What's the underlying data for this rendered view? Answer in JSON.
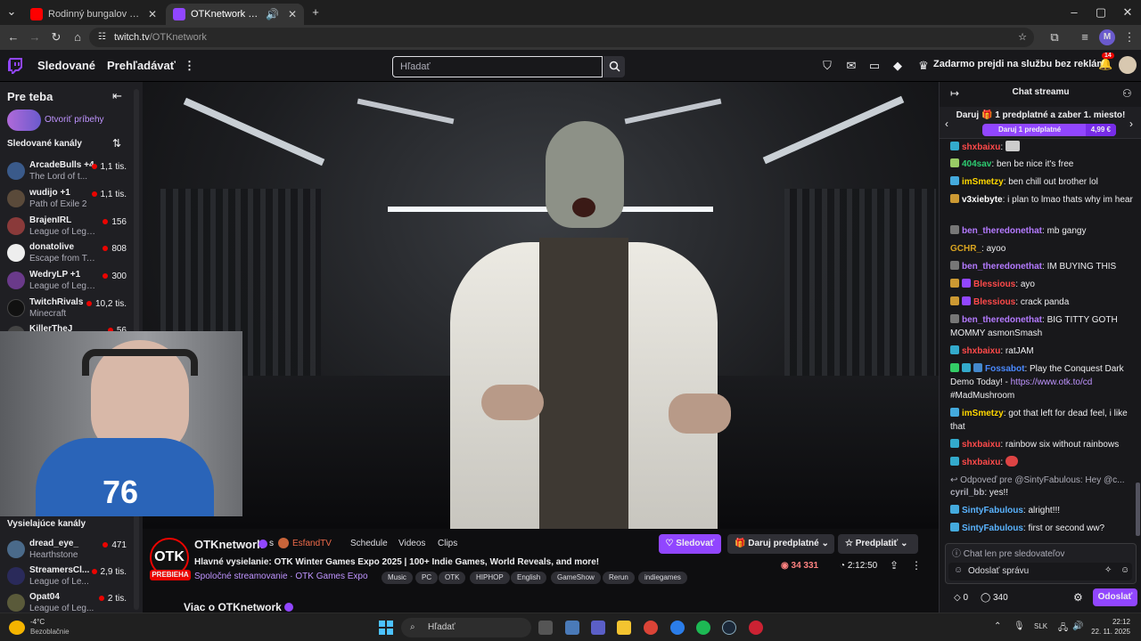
{
  "browser": {
    "tabs": [
      {
        "label": "Rodinný bungalov na pláži len ...",
        "favicon_color": "#ff0000"
      },
      {
        "label": "OTKnetwork - Twitch",
        "favicon_color": "#9146ff"
      }
    ],
    "url_host": "twitch.tv",
    "url_path": "/OTKnetwork",
    "profile_initial": "M"
  },
  "topnav": {
    "following": "Sledované",
    "browse": "Prehľadávať",
    "search_placeholder": "Hľadať",
    "prime_label": "Zadarmo prejdi na službu bez reklám",
    "notif_count": "14"
  },
  "sidebar": {
    "for_you": "Pre teba",
    "stories": "Otvoriť príbehy",
    "followed_title": "Sledované kanály",
    "followed": [
      {
        "name": "ArcadeBulls +4",
        "game": "The Lord of t...",
        "viewers": "1,1 tis.",
        "color": "#3a5a8a"
      },
      {
        "name": "wudijo +1",
        "game": "Path of Exile 2",
        "viewers": "1,1 tis.",
        "color": "#5a4a3a"
      },
      {
        "name": "BrajenIRL",
        "game": "League of Lege...",
        "viewers": "156",
        "color": "#8a3a3a"
      },
      {
        "name": "donatolive",
        "game": "Escape from Ta...",
        "viewers": "808",
        "color": "#eeeeee"
      },
      {
        "name": "WedryLP +1",
        "game": "League of Lege...",
        "viewers": "300",
        "color": "#6a3a8a"
      },
      {
        "name": "TwitchRivals",
        "game": "Minecraft",
        "viewers": "10,2 tis.",
        "color": "#111111"
      },
      {
        "name": "KillerTheJ",
        "game": "",
        "viewers": "56",
        "color": "#444444"
      }
    ],
    "live_title": "Vysielajúce kanály",
    "live": [
      {
        "name": "dread_eye_",
        "game": "Hearthstone",
        "viewers": "471",
        "color": "#4a6a8a"
      },
      {
        "name": "StreamersCl...",
        "game": "League of Le...",
        "viewers": "2,9 tis.",
        "color": "#2a2a5a"
      },
      {
        "name": "Opat04",
        "game": "League of Leg...",
        "viewers": "2 tis.",
        "color": "#5a5a3a"
      }
    ]
  },
  "channel": {
    "name": "OTKnetwork",
    "with_label": "s",
    "partner": "EsfandTV",
    "links": [
      "Schedule",
      "Videos",
      "Clips"
    ],
    "live_badge": "PREBIEHA",
    "title": "Hlavné vysielanie: OTK Winter Games Expo 2025 | 100+ Indie Games, World Reveals, and more!",
    "collab": "Spoločné streamovanie",
    "game": "OTK Games Expo",
    "tags": [
      "Music",
      "PC",
      "OTK",
      "HIPHOP",
      "English",
      "GameShow",
      "Rerun",
      "indiegames"
    ],
    "follow": "Sledovať",
    "gift": "Daruj predplatné",
    "subscribe": "Predplatiť",
    "viewers": "34 331",
    "uptime": "2:12:50",
    "about": "Viac o OTKnetwork"
  },
  "chat": {
    "title": "Chat streamu",
    "gift_banner": "Daruj 🎁 1 predplatné a zaber 1. miesto!",
    "gift_button": "Daruj 1 predplatné",
    "gift_price": "4,99 €",
    "messages": [
      {
        "user": "shxbaixu",
        "color": "#ff4a4a",
        "text": ""
      },
      {
        "user": "404sav",
        "color": "#2ecc71",
        "text": "ben be nice it's free"
      },
      {
        "user": "imSmetzy",
        "color": "#ffd700",
        "text": "ben chill out brother lol"
      },
      {
        "user": "v3xiebyte",
        "color": "#ffffff",
        "text": "i plan to lmao thats why im hear"
      },
      {
        "user": "ben_theredonethat",
        "color": "#b47aff",
        "text": "mb gangy"
      },
      {
        "user": "GCHR_",
        "color": "#daa520",
        "text": "ayoo"
      },
      {
        "user": "ben_theredonethat",
        "color": "#b47aff",
        "text": "IM BUYING THIS"
      },
      {
        "user": "Blessious",
        "color": "#ff4a4a",
        "text": "ayo"
      },
      {
        "user": "Blessious",
        "color": "#ff4a4a",
        "text": "crack panda"
      },
      {
        "user": "ben_theredonethat",
        "color": "#b47aff",
        "text": "BIG TITTY GOTH MOMMY asmonSmash"
      },
      {
        "user": "shxbaixu",
        "color": "#ff4a4a",
        "text": "ratJAM"
      },
      {
        "user": "Fossabot",
        "color": "#4a8aff",
        "text": "Play the Conquest Dark Demo Today! -",
        "link": "https://www.otk.to/cd",
        "after": "#MadMushroom"
      },
      {
        "user": "imSmetzy",
        "color": "#ffd700",
        "text": "got that left for dead feel, i like that"
      },
      {
        "user": "shxbaixu",
        "color": "#ff4a4a",
        "text": "rainbow six without rainbows"
      },
      {
        "user": "shxbaixu",
        "color": "#ff4a4a",
        "text": ""
      },
      {
        "user": "cyril_bb",
        "color": "#adadb8",
        "text": "yes!!",
        "reply": "Odpoveď pre @SintyFabulous: Hey @c..."
      },
      {
        "user": "SintyFabulous",
        "color": "#5ab4ff",
        "text": "alright!!!"
      },
      {
        "user": "SintyFabulous",
        "color": "#5ab4ff",
        "text": "first or second ww?"
      }
    ],
    "followers_only": "Chat len pre sledovateľov",
    "input_placeholder": "Odoslať správu",
    "bits": "0",
    "points": "340",
    "send": "Odoslať"
  },
  "taskbar": {
    "weather_temp": "-4°C",
    "weather_desc": "Bezoblačnie",
    "search": "Hľadať",
    "lang": "SLK",
    "time": "22:12",
    "date": "22. 11. 2025"
  }
}
